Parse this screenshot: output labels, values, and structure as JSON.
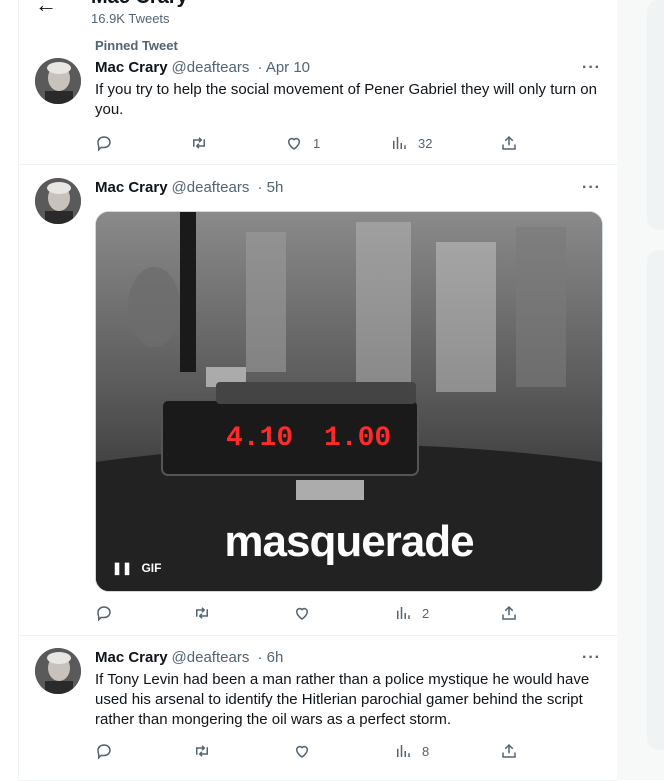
{
  "header": {
    "title": "Mac Crary",
    "tweet_count": "16.9K Tweets"
  },
  "pinned_label": "Pinned Tweet",
  "tweets": [
    {
      "name": "Mac Crary",
      "handle": "@deaftears",
      "time": "· Apr 10",
      "text": "If you try to help the social movement of Pener Gabriel they will only turn on you.",
      "likes": "1",
      "views": "32"
    },
    {
      "name": "Mac Crary",
      "handle": "@deaftears",
      "time": "· 5h",
      "media": {
        "caption": "masquerade",
        "gif_label": "GIF",
        "meter_left": "4.10",
        "meter_right": "1.00"
      },
      "views": "2"
    },
    {
      "name": "Mac Crary",
      "handle": "@deaftears",
      "time": "· 6h",
      "text": "If Tony Levin had been a man rather than a police mystique he would have used his arsenal to identify the Hitlerian parochial gamer behind the script rather than mongering the oil wars as a perfect storm.",
      "views": "8"
    }
  ],
  "icons": {
    "back": "back-arrow-icon",
    "more": "more-icon",
    "reply": "reply-icon",
    "retweet": "retweet-icon",
    "like": "like-icon",
    "views": "views-icon",
    "share": "share-icon",
    "pin": "pin-icon",
    "pause": "pause-icon"
  },
  "colors": {
    "secondary_text": "#536471",
    "border": "#eff3f4",
    "primary_text": "#0f1419"
  }
}
